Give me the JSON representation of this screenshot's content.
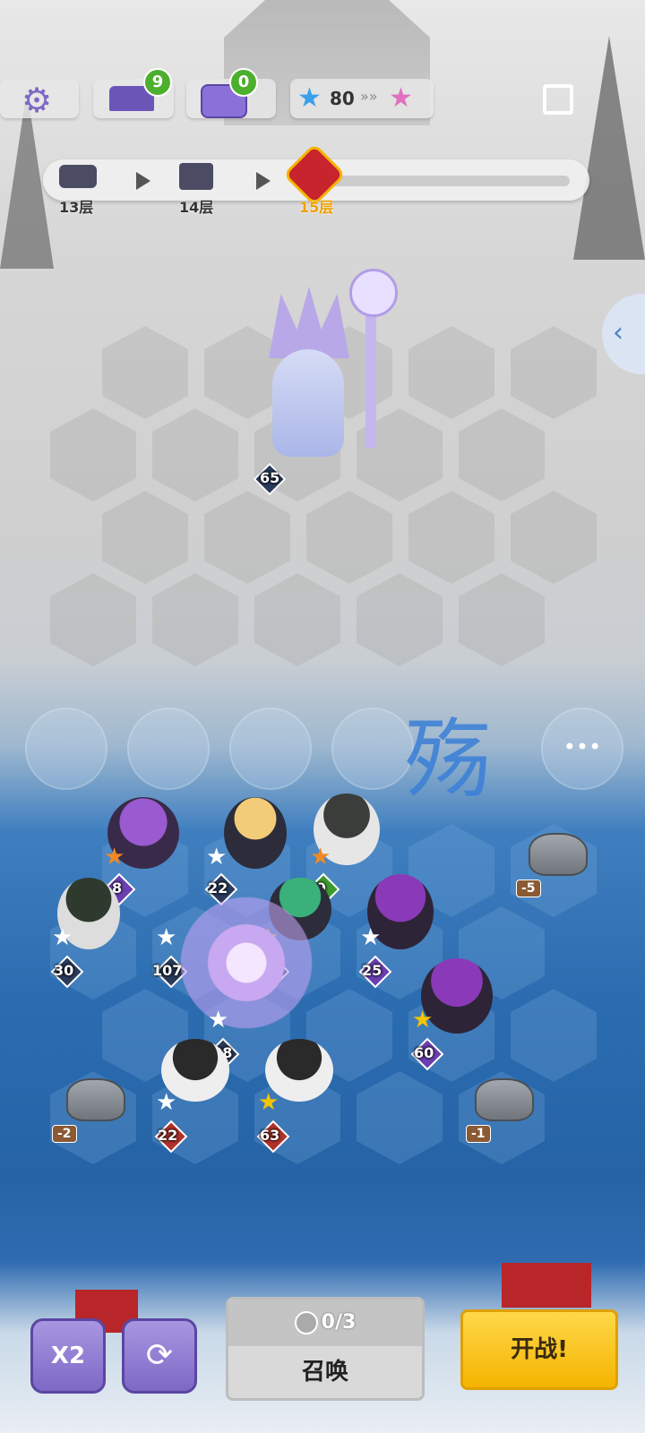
{
  "top_bar": {
    "settings_icon": "gear-icon",
    "anvil_badge": "9",
    "chest_badge": "0",
    "star_count": "80",
    "share_icon": "share-icon"
  },
  "floors": {
    "items": [
      {
        "label": "13层",
        "icon": "chest-icon"
      },
      {
        "label": "14层",
        "icon": "anvil-icon"
      },
      {
        "label": "15层",
        "icon": "demon-boss-icon"
      }
    ]
  },
  "boss": {
    "level": "65"
  },
  "watermark": "殇",
  "units": [
    {
      "level": "8",
      "star": "orange"
    },
    {
      "level": "22",
      "star": "white"
    },
    {
      "level": "9",
      "star": "orange"
    },
    {
      "level": "30",
      "star": "white"
    },
    {
      "level": "107",
      "star": "white"
    },
    {
      "level": "56",
      "star": "gold"
    },
    {
      "level": "25",
      "star": "white"
    },
    {
      "level": "60",
      "star": "gold"
    },
    {
      "level": "108",
      "star": "white"
    },
    {
      "level": "22",
      "star": "white"
    },
    {
      "level": "63",
      "star": "gold"
    }
  ],
  "rocks": [
    "-5",
    "-2",
    "-1"
  ],
  "controls": {
    "speed_label": "X2",
    "refresh_icon": "refresh-icon",
    "summon_count": "0/3",
    "summon_label": "召唤",
    "fight_label": "开战!",
    "more_label": "•••"
  },
  "colors": {
    "accent": "#f5b400",
    "purple_button": "#7d68c6",
    "badge_green": "#4caf2e"
  }
}
